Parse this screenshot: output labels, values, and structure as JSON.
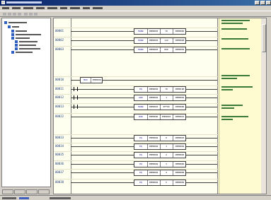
{
  "rungs": [
    {
      "num": "00001",
      "type": "fb",
      "cols": [
        {
          "t": "MAND",
          "op": true
        },
        {
          "t": "XMEB003"
        },
        {
          "t": "70"
        },
        {
          "t": "XMEB006"
        }
      ]
    },
    {
      "num": "00002",
      "type": "fb",
      "cols": [
        {
          "t": "MAND",
          "op": true
        },
        {
          "t": "XMEB003"
        },
        {
          "t": "112"
        },
        {
          "t": "XMEB008"
        }
      ]
    },
    {
      "num": "00003",
      "type": "fb",
      "cols": [
        {
          "t": "MAND",
          "op": true
        },
        {
          "t": "XMEB003"
        },
        {
          "t": "896"
        },
        {
          "t": "XMEB002"
        }
      ]
    },
    {
      "num": "00010",
      "type": "fb",
      "cols": [
        {
          "t": "MOV",
          "op": true
        },
        {
          "t": "XMEB001"
        }
      ]
    },
    {
      "num": "00011",
      "type": "fb",
      "cols": [
        {
          "t": "EQ",
          "op": true
        },
        {
          "t": "XMEB002"
        },
        {
          "t": "70"
        },
        {
          "t": "XMEB100"
        }
      ]
    },
    {
      "num": "00012",
      "type": "fb",
      "cols": [
        {
          "t": "ADD",
          "op": true
        },
        {
          "t": "XMEB002"
        },
        {
          "t": "1"
        },
        {
          "t": "XMEB002"
        }
      ]
    },
    {
      "num": "00013",
      "type": "fb",
      "cols": [
        {
          "t": "MAND",
          "op": true
        },
        {
          "t": "XMEB003"
        },
        {
          "t": "0FF00"
        },
        {
          "t": "XMEB006"
        }
      ]
    },
    {
      "num": "00022",
      "type": "fb",
      "cols": [
        {
          "t": "WOR",
          "op": true
        },
        {
          "t": "XMEB006"
        },
        {
          "t": "XMEB003"
        },
        {
          "t": "XMEB010"
        }
      ]
    },
    {
      "num": "00033",
      "type": "fb",
      "cols": [
        {
          "t": "EQ",
          "op": true
        },
        {
          "t": "XMEB002"
        },
        {
          "t": "0"
        },
        {
          "t": "XMEB003"
        }
      ]
    },
    {
      "num": "00034",
      "type": "fb",
      "cols": [
        {
          "t": "EQ",
          "op": true
        },
        {
          "t": "XMEB002"
        },
        {
          "t": "1"
        },
        {
          "t": "XMEB004"
        }
      ]
    },
    {
      "num": "00035",
      "type": "fb",
      "cols": [
        {
          "t": "EQ",
          "op": true
        },
        {
          "t": "XMEB002"
        },
        {
          "t": "2"
        },
        {
          "t": "XMEB005"
        }
      ]
    },
    {
      "num": "00036",
      "type": "fb",
      "cols": [
        {
          "t": "EQ",
          "op": true
        },
        {
          "t": "XMEB002"
        },
        {
          "t": "3"
        },
        {
          "t": "XMEB006"
        }
      ]
    },
    {
      "num": "00037",
      "type": "fb",
      "cols": [
        {
          "t": "EQ",
          "op": true
        },
        {
          "t": "XMEB002"
        },
        {
          "t": "4"
        },
        {
          "t": "XMEB008"
        }
      ]
    },
    {
      "num": "00038",
      "type": "fb",
      "cols": [
        {
          "t": "EQ",
          "op": true
        },
        {
          "t": "XMEB002"
        },
        {
          "t": "5"
        },
        {
          "t": "XMEB009"
        }
      ]
    }
  ],
  "colors": {
    "window_frame": "#d4d0c8",
    "ladder_bg": "#fffff0",
    "comment_bg": "#fffbd0",
    "comment_text": "#3a7a3a",
    "title_grad": "#0a246a"
  }
}
